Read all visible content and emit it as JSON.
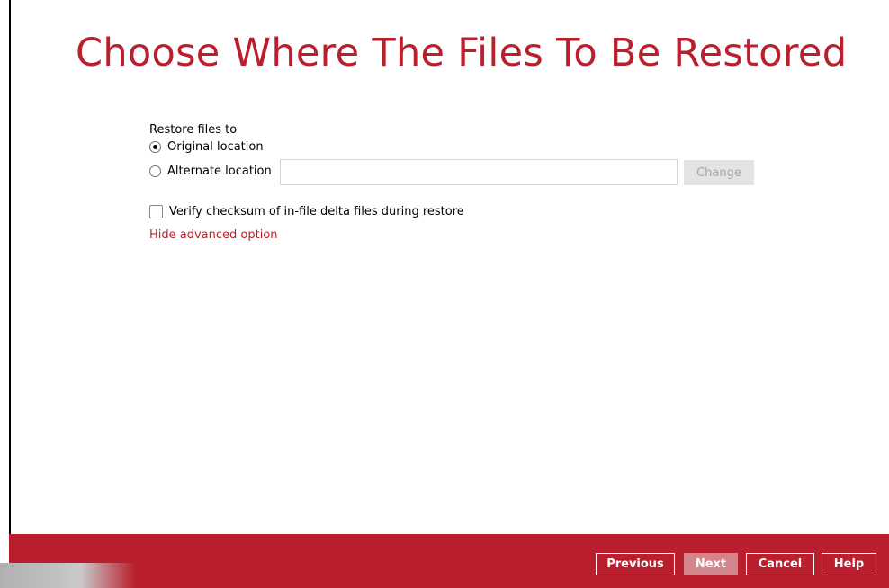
{
  "page": {
    "title": "Choose Where The Files To Be Restored"
  },
  "restore": {
    "label": "Restore files to",
    "options": [
      {
        "label": "Original location",
        "selected": true
      },
      {
        "label": "Alternate location",
        "selected": false
      }
    ],
    "alternate_path": {
      "value": "",
      "placeholder": ""
    },
    "change_label": "Change"
  },
  "advanced": {
    "verify_checksum_label": "Verify checksum of in-file delta files during restore",
    "verify_checksum_checked": false,
    "hide_link": "Hide advanced option"
  },
  "footer": {
    "previous_label": "Previous",
    "next_label": "Next",
    "cancel_label": "Cancel",
    "help_label": "Help"
  },
  "colors": {
    "accent": "#b91f2d",
    "disabled_button_bg": "#e4e4e4",
    "disabled_button_text": "#a7a7a7"
  }
}
